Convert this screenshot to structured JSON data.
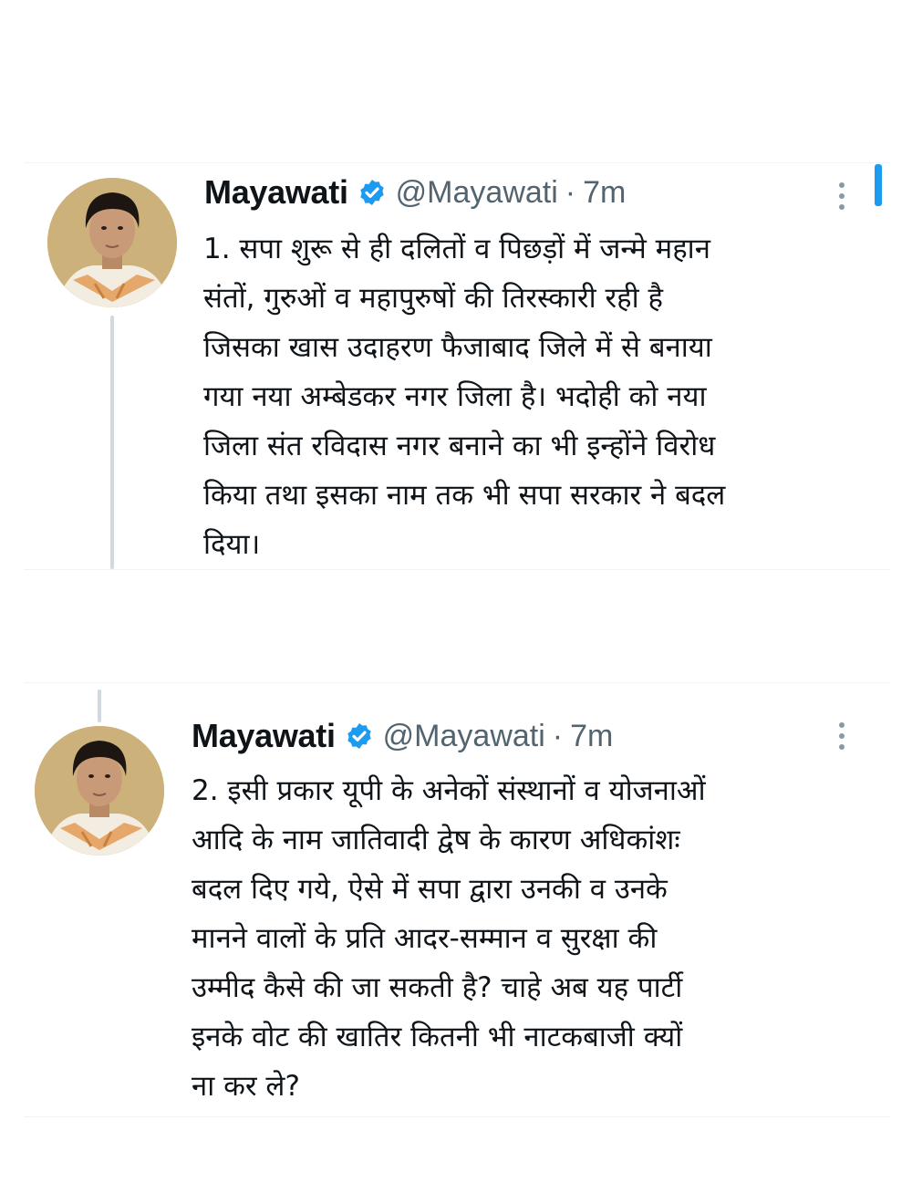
{
  "tweets": [
    {
      "author_name": "Mayawati",
      "handle": "@Mayawati",
      "separator": "·",
      "time": "7m",
      "text": "1. सपा शुरू से ही दलितों व पिछड़ों में जन्मे महान\nसंतों, गुरुओं व महापुरुषों की तिरस्कारी रही है\nजिसका खास उदाहरण फैजाबाद जिले में से बनाया\nगया नया अम्बेडकर नगर जिला है। भदोही को नया\nजिला संत रविदास नगर बनाने का भी इन्होंने विरोध\nकिया तथा इसका नाम तक भी सपा सरकार ने बदल\nदिया।"
    },
    {
      "author_name": "Mayawati",
      "handle": "@Mayawati",
      "separator": "·",
      "time": "7m",
      "text": "2. इसी प्रकार यूपी के अनेकों संस्थानों व योजनाओं\nआदि के नाम जातिवादी द्वेष के कारण अधिकांशः\nबदल दिए गये, ऐसे में सपा द्वारा उनकी व उनके\nमानने वालों के प्रति आदर-सम्मान व सुरक्षा की\nउम्मीद कैसे की जा सकती है? चाहे अब यह पार्टी\nइनके वोट की खातिर कितनी भी नाटकबाजी क्यों\nना कर ले?"
    }
  ],
  "colors": {
    "verified": "#1d9bf0",
    "muted": "#536471",
    "text": "#0f1419",
    "thread_line": "#cfd9de"
  },
  "icons": [
    "verified-badge-icon",
    "more-options-icon",
    "avatar-photo"
  ]
}
